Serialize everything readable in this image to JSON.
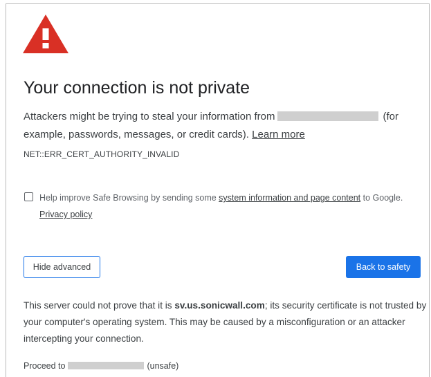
{
  "icon": {
    "name": "warning-triangle-icon",
    "color": "#d93025"
  },
  "heading": "Your connection is not private",
  "intro": {
    "before": "Attackers might be trying to steal your information from",
    "after": "(for example, passwords, messages, or credit cards).",
    "learn_more": "Learn more"
  },
  "error_code": "NET::ERR_CERT_AUTHORITY_INVALID",
  "safe_browsing": {
    "checked": false,
    "before": "Help improve Safe Browsing by sending some",
    "link": "system information and page content",
    "after": "to Google.",
    "privacy_link": "Privacy policy"
  },
  "buttons": {
    "hide_advanced": "Hide advanced",
    "back_to_safety": "Back to safety"
  },
  "advanced": {
    "before": "This server could not prove that it is",
    "domain": "sv.us.sonicwall.com",
    "after": "; its security certificate is not trusted by your computer's operating system. This may be caused by a misconfiguration or an attacker intercepting your connection."
  },
  "proceed": {
    "before": "Proceed to",
    "after": "(unsafe)"
  },
  "colors": {
    "primary": "#1a73e8",
    "text": "#3c4043",
    "warning": "#d93025"
  }
}
